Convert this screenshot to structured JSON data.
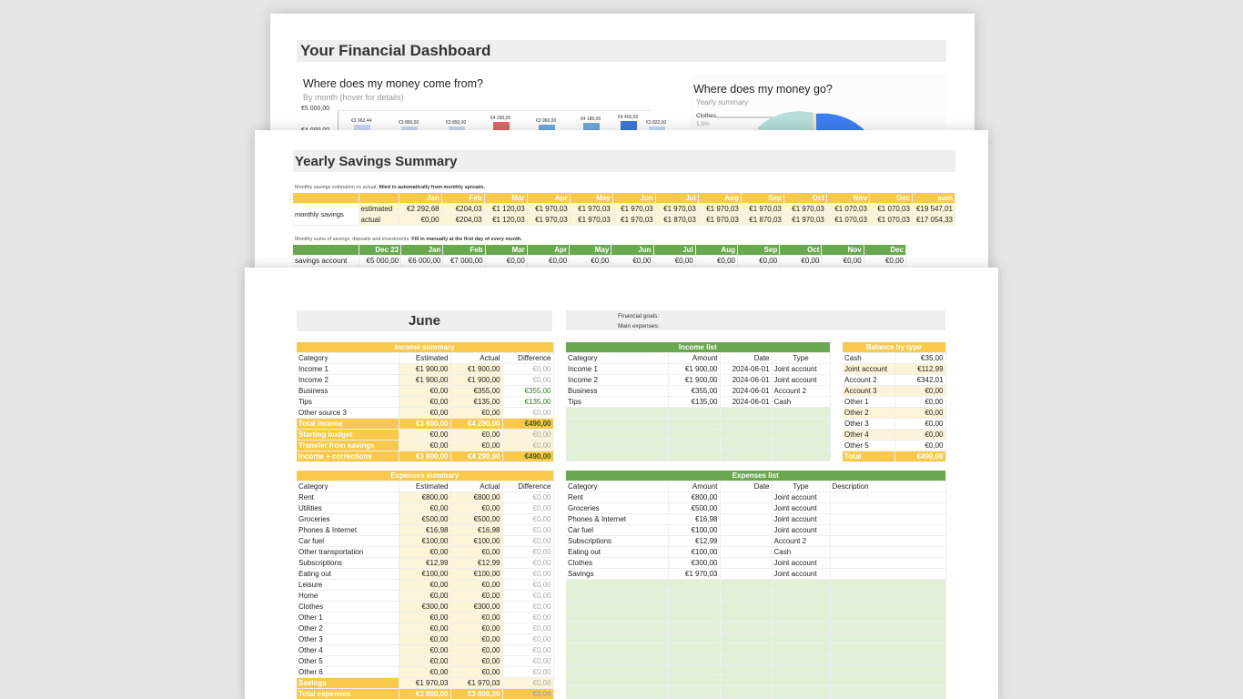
{
  "dashboard": {
    "title": "Your Financial Dashboard",
    "income_chart": {
      "title": "Where does my money come from?",
      "subtitle": "By month (hover for details)",
      "y_ticks": [
        "€5 000,00",
        "€4 000,00"
      ],
      "bar_labels": [
        "€3 962,44",
        "€3 800,00",
        "€3 850,00",
        "€4 290,00",
        "€3 960,00",
        "€4 180,00",
        "€4 400,00",
        "€3 822,00"
      ]
    },
    "expense_chart": {
      "title": "Where does my money go?",
      "subtitle": "Yearly summary",
      "slice_label": "Clothes",
      "slice_pct": "1,5%"
    }
  },
  "chart_data": {
    "type": "bar",
    "title": "Where does my money come from?",
    "subtitle": "By month (hover for details)",
    "values": [
      3962.44,
      3800.0,
      3850.0,
      4290.0,
      3960.0,
      4180.0,
      4400.0,
      3822.0
    ],
    "ylim": [
      0,
      5000
    ]
  },
  "yearly": {
    "title": "Yearly Savings Summary",
    "note1_a": "Monthly savings estimation vs actual,",
    "note1_b": "filled in automatically from monthly spreads.",
    "months": [
      "Jan",
      "Feb",
      "Mar",
      "Apr",
      "May",
      "Jun",
      "Jul",
      "Aug",
      "Sep",
      "Oct",
      "Nov",
      "Dec",
      "sum"
    ],
    "row_label": "monthly savings",
    "estimated_label": "estimated",
    "actual_label": "actual",
    "estimated": [
      "€2 292,68",
      "€204,03",
      "€1 120,03",
      "€1 970,03",
      "€1 970,03",
      "€1 970,03",
      "€1 970,03",
      "€1 970,03",
      "€1 970,03",
      "€1 970,03",
      "€1 070,03",
      "€1 070,03",
      "€19 547,01"
    ],
    "actual": [
      "€0,00",
      "€204,03",
      "€1 120,03",
      "€1 970,03",
      "€1 970,03",
      "€1 970,03",
      "€1 870,03",
      "€1 970,03",
      "€1 870,03",
      "€1 970,03",
      "€1 070,03",
      "€1 070,03",
      "€17 054,33"
    ],
    "note2_a": "Monthly sums of savings, deposits and investments.",
    "note2_b": "Fill in manually at the first day of every month.",
    "months2": [
      "Dec 23",
      "Jan",
      "Feb",
      "Mar",
      "Apr",
      "May",
      "Jun",
      "Jul",
      "Aug",
      "Sep",
      "Oct",
      "Nov",
      "Dec"
    ],
    "savings_label": "savings account",
    "savings": [
      "€5 000,00",
      "€6 000,00",
      "€7 000,00",
      "€0,00",
      "€0,00",
      "€0,00",
      "€0,00",
      "€0,00",
      "€0,00",
      "€0,00",
      "€0,00",
      "€0,00",
      "€0,00"
    ]
  },
  "june": {
    "title": "June",
    "goals_label": "Financial goals:",
    "main_expenses_label": "Main expenses:",
    "income_summary": {
      "title": "Income summary",
      "headers": [
        "Category",
        "Estimated",
        "Actual",
        "Difference"
      ],
      "rows": [
        [
          "Income 1",
          "€1 900,00",
          "€1 900,00",
          "€0,00"
        ],
        [
          "Income 2",
          "€1 900,00",
          "€1 900,00",
          "€0,00"
        ],
        [
          "Business",
          "€0,00",
          "€355,00",
          "€355,00"
        ],
        [
          "Tips",
          "€0,00",
          "€135,00",
          "€135,00"
        ],
        [
          "Other source 3",
          "€0,00",
          "€0,00",
          "€0,00"
        ]
      ],
      "total": [
        "Total income",
        "€3 800,00",
        "€4 290,00",
        "€490,00"
      ],
      "starting": [
        "Starting budget",
        "€0,00",
        "€0,00",
        "€0,00"
      ],
      "transfer": [
        "Transfer from savings",
        "€0,00",
        "€0,00",
        "€0,00"
      ],
      "corrections": [
        "Income + corrections",
        "€3 800,00",
        "€4 290,00",
        "€490,00"
      ]
    },
    "income_list": {
      "title": "Income list",
      "headers": [
        "Category",
        "Amount",
        "Date",
        "Type"
      ],
      "rows": [
        [
          "Income 1",
          "€1 900,00",
          "2024-06-01",
          "Joint account"
        ],
        [
          "Income 2",
          "€1 900,00",
          "2024-06-01",
          "Joint account"
        ],
        [
          "Business",
          "€355,00",
          "2024-06-01",
          "Account 2"
        ],
        [
          "Tips",
          "€135,00",
          "2024-06-01",
          "Cash"
        ]
      ]
    },
    "balance": {
      "title": "Balance by type",
      "rows": [
        [
          "Cash",
          "€35,00"
        ],
        [
          "Joint account",
          "€112,99"
        ],
        [
          "Account 2",
          "€342,01"
        ],
        [
          "Account 3",
          "€0,00"
        ],
        [
          "Other 1",
          "€0,00"
        ],
        [
          "Other 2",
          "€0,00"
        ],
        [
          "Other 3",
          "€0,00"
        ],
        [
          "Other 4",
          "€0,00"
        ],
        [
          "Other 5",
          "€0,00"
        ]
      ],
      "total": [
        "Total",
        "€490,00"
      ]
    },
    "expenses_summary": {
      "title": "Expenses summary",
      "headers": [
        "Category",
        "Estimated",
        "Actual",
        "Difference"
      ],
      "rows": [
        [
          "Rent",
          "€800,00",
          "€800,00",
          "€0,00"
        ],
        [
          "Utilities",
          "€0,00",
          "€0,00",
          "€0,00"
        ],
        [
          "Groceries",
          "€500,00",
          "€500,00",
          "€0,00"
        ],
        [
          "Phones & Internet",
          "€16,98",
          "€16,98",
          "€0,00"
        ],
        [
          "Car fuel",
          "€100,00",
          "€100,00",
          "€0,00"
        ],
        [
          "Other transportation",
          "€0,00",
          "€0,00",
          "€0,00"
        ],
        [
          "Subscriptions",
          "€12,99",
          "€12,99",
          "€0,00"
        ],
        [
          "Eating out",
          "€100,00",
          "€100,00",
          "€0,00"
        ],
        [
          "Leisure",
          "€0,00",
          "€0,00",
          "€0,00"
        ],
        [
          "Home",
          "€0,00",
          "€0,00",
          "€0,00"
        ],
        [
          "Clothes",
          "€300,00",
          "€300,00",
          "€0,00"
        ],
        [
          "Other 1",
          "€0,00",
          "€0,00",
          "€0,00"
        ],
        [
          "Other 2",
          "€0,00",
          "€0,00",
          "€0,00"
        ],
        [
          "Other 3",
          "€0,00",
          "€0,00",
          "€0,00"
        ],
        [
          "Other 4",
          "€0,00",
          "€0,00",
          "€0,00"
        ],
        [
          "Other 5",
          "€0,00",
          "€0,00",
          "€0,00"
        ],
        [
          "Other 6",
          "€0,00",
          "€0,00",
          "€0,00"
        ]
      ],
      "savings": [
        "Savings",
        "€1 970,03",
        "€1 970,03",
        "€0,00"
      ],
      "total": [
        "Total expenses",
        "€3 800,00",
        "€3 800,00",
        "€0,00"
      ]
    },
    "expenses_list": {
      "title": "Expenses list",
      "headers": [
        "Category",
        "Amount",
        "Date",
        "Type",
        "Description"
      ],
      "rows": [
        [
          "Rent",
          "€800,00",
          "",
          "Joint account",
          ""
        ],
        [
          "Groceries",
          "€500,00",
          "",
          "Joint account",
          ""
        ],
        [
          "Phones & Internet",
          "€16,98",
          "",
          "Joint account",
          ""
        ],
        [
          "Car fuel",
          "€100,00",
          "",
          "Joint account",
          ""
        ],
        [
          "Subscriptions",
          "€12,99",
          "",
          "Account 2",
          ""
        ],
        [
          "Eating out",
          "€100,00",
          "",
          "Cash",
          ""
        ],
        [
          "Clothes",
          "€300,00",
          "",
          "Joint account",
          ""
        ],
        [
          "Savings",
          "€1 970,03",
          "",
          "Joint account",
          ""
        ]
      ]
    }
  }
}
